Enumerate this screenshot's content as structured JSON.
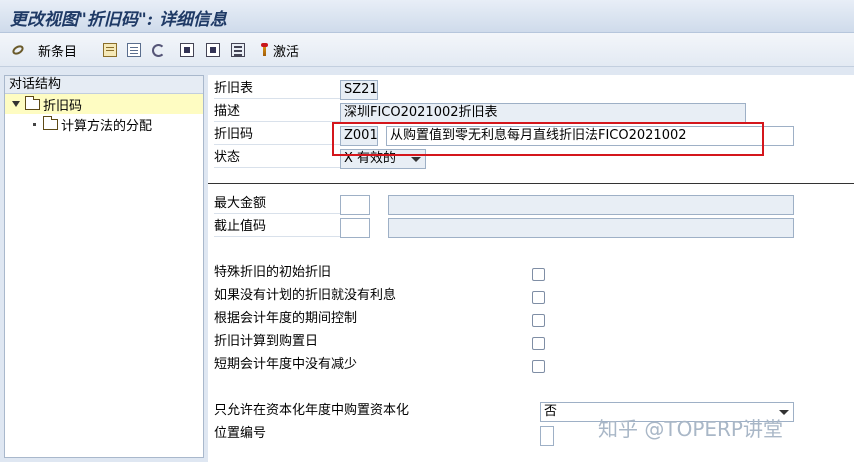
{
  "window": {
    "title": "更改视图\"折旧码\": 详细信息"
  },
  "toolbar": {
    "items": [
      {
        "icon": "glasses-icon"
      },
      {
        "icon": "new-entries-icon",
        "label": "新条目"
      },
      {
        "icon": "copy-icon"
      },
      {
        "icon": "delete-icon"
      },
      {
        "icon": "undo-icon"
      },
      {
        "icon": "select-all-icon"
      },
      {
        "icon": "select-block-icon"
      },
      {
        "icon": "deselect-icon"
      },
      {
        "icon": "activate-icon",
        "label": "激活"
      }
    ]
  },
  "dialog_structure": {
    "header": "对话结构",
    "items": [
      {
        "label": "折旧码",
        "level": 0,
        "selected": true
      },
      {
        "label": "计算方法的分配",
        "level": 1,
        "selected": false
      }
    ]
  },
  "form": {
    "table_label": "折旧表",
    "table_value": "SZ21",
    "desc_label": "描述",
    "desc_value": "深圳FICO2021002折旧表",
    "key_label": "折旧码",
    "key_value": "Z001",
    "key_desc": "从购置值到零无利息每月直线折旧法FICO2021002",
    "status_label": "状态",
    "status_value": "X 有效的",
    "max_amount_label": "最大金额",
    "max_amount_value": "",
    "cutoff_label": "截止值码",
    "cutoff_value": "",
    "checkboxes": [
      {
        "label": "特殊折旧的初始折旧",
        "checked": false
      },
      {
        "label": "如果没有计划的折旧就没有利息",
        "checked": false
      },
      {
        "label": "根据会计年度的期间控制",
        "checked": false
      },
      {
        "label": "折旧计算到购置日",
        "checked": false
      },
      {
        "label": "短期会计年度中没有减少",
        "checked": false
      }
    ],
    "capitalization_label": "只允许在资本化年度中购置资本化",
    "capitalization_value": "否",
    "position_label": "位置编号",
    "position_value": ""
  },
  "watermark": "知乎 @TOPERP讲堂",
  "colors": {
    "highlight": "#d4161c",
    "title": "#1f3a66",
    "selected_row": "#fefcc2"
  }
}
